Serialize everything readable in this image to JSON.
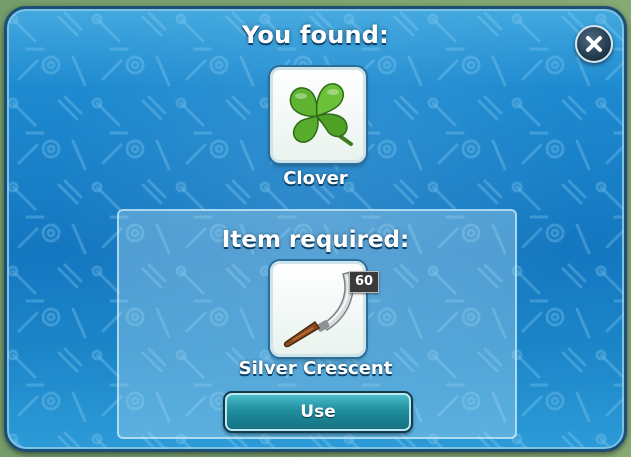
{
  "dialog": {
    "title": "You found:",
    "close_icon": "close-icon"
  },
  "found_item": {
    "name": "Clover",
    "icon": "clover-icon"
  },
  "required_section": {
    "title": "Item required:",
    "item": {
      "name": "Silver Crescent",
      "icon": "crescent-blade-icon",
      "count": "60"
    },
    "use_label": "Use"
  },
  "colors": {
    "dialog_blue": "#1e8ad0",
    "border_dark": "#1b4f75",
    "button_teal": "#1f8e9e",
    "badge_dark": "#3a3a3a"
  }
}
